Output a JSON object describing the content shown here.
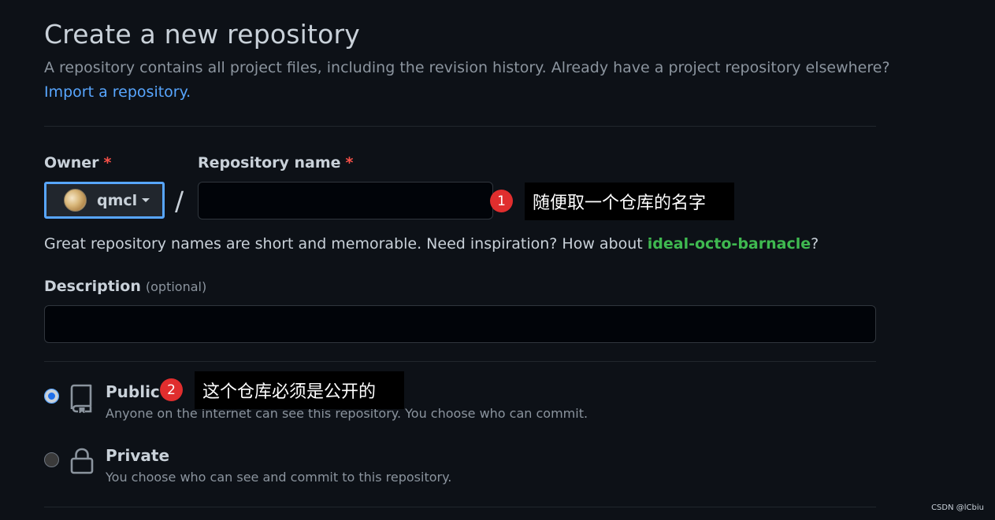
{
  "header": {
    "title": "Create a new repository",
    "subtitle": "A repository contains all project files, including the revision history. Already have a project repository elsewhere?",
    "import_link": "Import a repository."
  },
  "owner": {
    "label": "Owner",
    "required_mark": "*",
    "value": "qmcl"
  },
  "repo_name": {
    "label": "Repository name",
    "required_mark": "*",
    "value": "",
    "slash": "/"
  },
  "annotations": {
    "one": {
      "number": "1",
      "text": "随便取一个仓库的名字"
    },
    "two": {
      "number": "2",
      "text": "这个仓库必须是公开的"
    }
  },
  "hint": {
    "prefix": "Great repository names are short and memorable. Need inspiration? How about ",
    "suggestion": "ideal-octo-barnacle",
    "suffix": "?"
  },
  "description": {
    "label": "Description",
    "optional": "(optional)",
    "value": ""
  },
  "visibility": {
    "public": {
      "title": "Public",
      "desc": "Anyone on the internet can see this repository. You choose who can commit.",
      "checked": true,
      "icon": "repo-icon"
    },
    "private": {
      "title": "Private",
      "desc": "You choose who can see and commit to this repository.",
      "checked": false,
      "icon": "lock-icon"
    }
  },
  "watermark": "CSDN @lCbiu",
  "colors": {
    "background": "#0d1117",
    "link": "#58a6ff",
    "suggestion": "#3fb950",
    "required": "#f85149",
    "badge": "#e02e2e"
  }
}
